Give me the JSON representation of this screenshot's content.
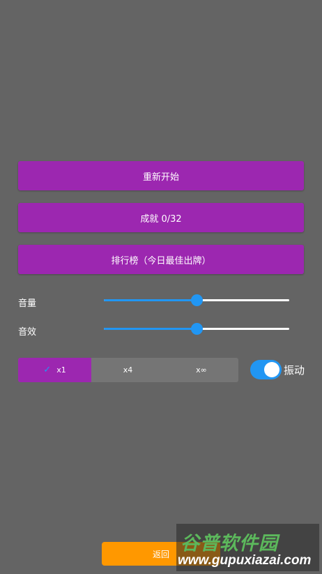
{
  "menu": {
    "restart_label": "重新开始",
    "achievements_label": "成就 0/32",
    "leaderboard_label": "排行榜（今日最佳出牌）"
  },
  "settings": {
    "volume": {
      "label": "音量",
      "value_fraction": 0.5
    },
    "sound_effects": {
      "label": "音效",
      "value_fraction": 0.5
    }
  },
  "speed_selector": {
    "options": [
      {
        "label": "x1",
        "selected": true
      },
      {
        "label": "x4",
        "selected": false
      },
      {
        "label": "x∞",
        "selected": false
      }
    ],
    "check_icon": "check-icon"
  },
  "vibration": {
    "label": "振动",
    "enabled": true
  },
  "back_label": "返回",
  "watermark": {
    "title": "谷普软件园",
    "url": "www.gupuxiazai.com"
  },
  "colors": {
    "background": "#646464",
    "primary_button": "#9c27b0",
    "accent": "#2196f3",
    "back_button": "#ff9800",
    "segment_bg": "#757575"
  }
}
